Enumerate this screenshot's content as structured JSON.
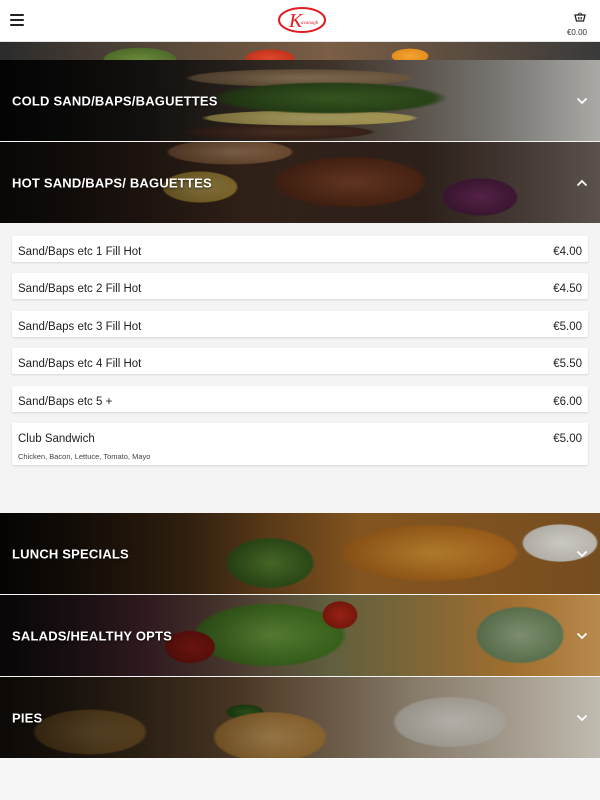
{
  "header": {
    "menu_icon": "hamburger-icon",
    "logo_letter": "K",
    "logo_word": "Kavanagh",
    "cart_icon": "basket-icon",
    "cart_total": "€0.00",
    "brand_color": "#e01b22"
  },
  "categories": [
    {
      "label": "",
      "state": "partial"
    },
    {
      "label": "COLD SAND/BAPS/BAGUETTES",
      "state": "collapsed",
      "chevron": "chevron-down-icon"
    },
    {
      "label": "HOT SAND/BAPS/ BAGUETTES",
      "state": "expanded",
      "chevron": "chevron-up-icon"
    },
    {
      "label": "LUNCH SPECIALS",
      "state": "collapsed",
      "chevron": "chevron-down-icon"
    },
    {
      "label": "SALADS/HEALTHY OPTS",
      "state": "collapsed",
      "chevron": "chevron-down-icon"
    },
    {
      "label": "PIES",
      "state": "collapsed",
      "chevron": "chevron-down-icon"
    }
  ],
  "items": [
    {
      "name": "Sand/Baps etc 1 Fill Hot",
      "price": "€4.00",
      "desc": ""
    },
    {
      "name": "Sand/Baps etc 2 Fill Hot",
      "price": "€4.50",
      "desc": ""
    },
    {
      "name": "Sand/Baps etc 3 Fill Hot",
      "price": "€5.00",
      "desc": ""
    },
    {
      "name": "Sand/Baps etc 4 Fill Hot",
      "price": "€5.50",
      "desc": ""
    },
    {
      "name": "Sand/Baps etc 5 +",
      "price": "€6.00",
      "desc": ""
    },
    {
      "name": "Club Sandwich",
      "price": "€5.00",
      "desc": "Chicken, Bacon, Lettuce, Tomato, Mayo"
    }
  ]
}
